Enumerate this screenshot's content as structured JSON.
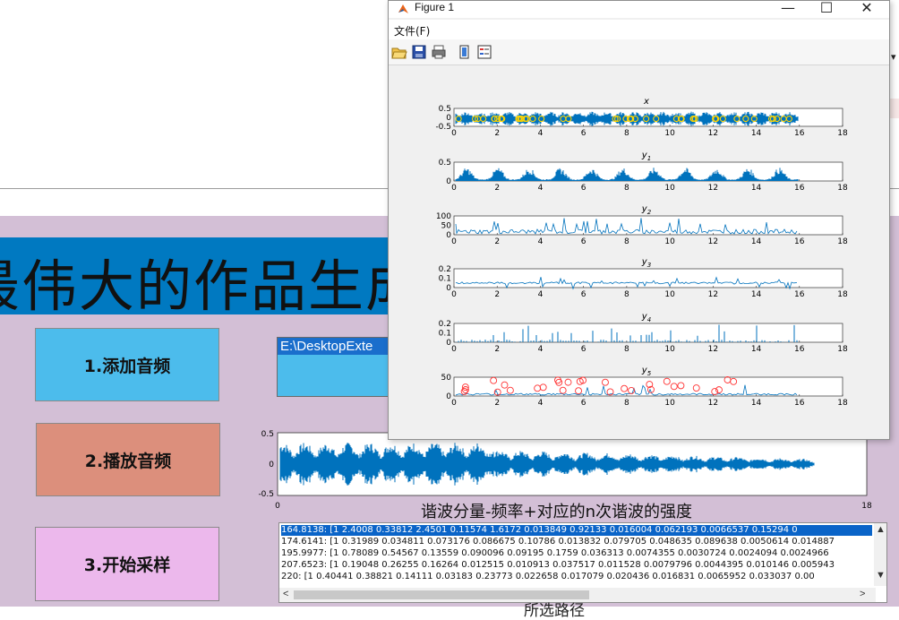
{
  "app": {
    "title": "最伟大的作品生成器",
    "buttons": {
      "add_audio": "1.添加音频",
      "play_audio": "2.播放音频",
      "sample": "3.开始采样"
    },
    "file_path": "E:\\DesktopExte",
    "table_title": "谐波分量-频率+对应的n次谐波的强度",
    "bottom_label": "所选路径",
    "waveform": {
      "y_ticks": [
        "0.5",
        "0",
        "-0.5"
      ],
      "x_ticks": [
        "0",
        "18"
      ]
    },
    "harmonic_rows": [
      "164.8138: [1      2.4008      0.33812      2.4501      0.11574      1.6172      0.013849      0.92133      0.016004      0.062193      0.0066537      0.15294    0",
      "174.6141: [1      0.31989    0.034811    0.073176     0.086675     0.10786     0.013832     0.079705     0.048635     0.089638     0.0050614     0.014887",
      "195.9977: [1      0.78089      0.54567      0.13559     0.090096      0.09195       0.1759      0.036313     0.0074355     0.0030724     0.0024094     0.0024966",
      "207.6523: [1      0.19048      0.26255      0.16264     0.012515     0.010913     0.037517     0.011528     0.0079796     0.0044395     0.010146     0.005943",
      "220: [1       0.40441      0.38821      0.14111      0.03183      0.23773      0.022658      0.017079      0.020436      0.016831      0.0065952     0.033037     0.00"
    ]
  },
  "figure": {
    "window_title": "Figure 1",
    "menu_file": "文件(F)",
    "x_ticks": [
      "0",
      "2",
      "4",
      "6",
      "8",
      "10",
      "12",
      "14",
      "16",
      "18"
    ],
    "subplots": [
      {
        "name": "x",
        "title": "x",
        "y_ticks": [
          "0.5",
          "0",
          "-0.5"
        ]
      },
      {
        "name": "y1",
        "title": "y",
        "sub": "1",
        "y_ticks": [
          "0.5",
          "0"
        ]
      },
      {
        "name": "y2",
        "title": "y",
        "sub": "2",
        "y_ticks": [
          "100",
          "50",
          "0"
        ]
      },
      {
        "name": "y3",
        "title": "y",
        "sub": "3",
        "y_ticks": [
          "0.2",
          "0.1",
          "0"
        ]
      },
      {
        "name": "y4",
        "title": "y",
        "sub": "4",
        "y_ticks": [
          "0.2",
          "0.1",
          "0"
        ]
      },
      {
        "name": "y5",
        "title": "y",
        "sub": "5",
        "y_ticks": [
          "50",
          "0"
        ]
      }
    ]
  },
  "colors": {
    "line": "#0072bd",
    "marker": "#ff3333",
    "highlight": "#ffd400",
    "title_banner": "#0079c1",
    "app_bg": "#d3bfd6",
    "btn_add": "#4cbcec",
    "btn_play": "#dc8f7c",
    "btn_sample": "#ecb8ec"
  }
}
